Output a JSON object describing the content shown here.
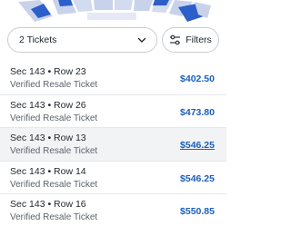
{
  "filters": {
    "quantity_label": "2 Tickets",
    "filters_label": "Filters",
    "quantity_icon": "chevron-down-icon",
    "filters_icon": "sliders-icon"
  },
  "colors": {
    "price": "#1b5fbf",
    "highlight_row": "#f2f3f5",
    "map_section_blue": "#2c5fc9",
    "map_section_light": "#c8d2ea"
  },
  "listings": [
    {
      "title": "Sec 143 • Row 23",
      "subtitle": "Verified Resale Ticket",
      "price": "$402.50",
      "highlighted": false
    },
    {
      "title": "Sec 143 • Row 26",
      "subtitle": "Verified Resale Ticket",
      "price": "$473.80",
      "highlighted": false
    },
    {
      "title": "Sec 143 • Row 13",
      "subtitle": "Verified Resale Ticket",
      "price": "$546.25",
      "highlighted": true
    },
    {
      "title": "Sec 143 • Row 14",
      "subtitle": "Verified Resale Ticket",
      "price": "$546.25",
      "highlighted": false
    },
    {
      "title": "Sec 143 • Row 16",
      "subtitle": "Verified Resale Ticket",
      "price": "$550.85",
      "highlighted": false
    }
  ]
}
